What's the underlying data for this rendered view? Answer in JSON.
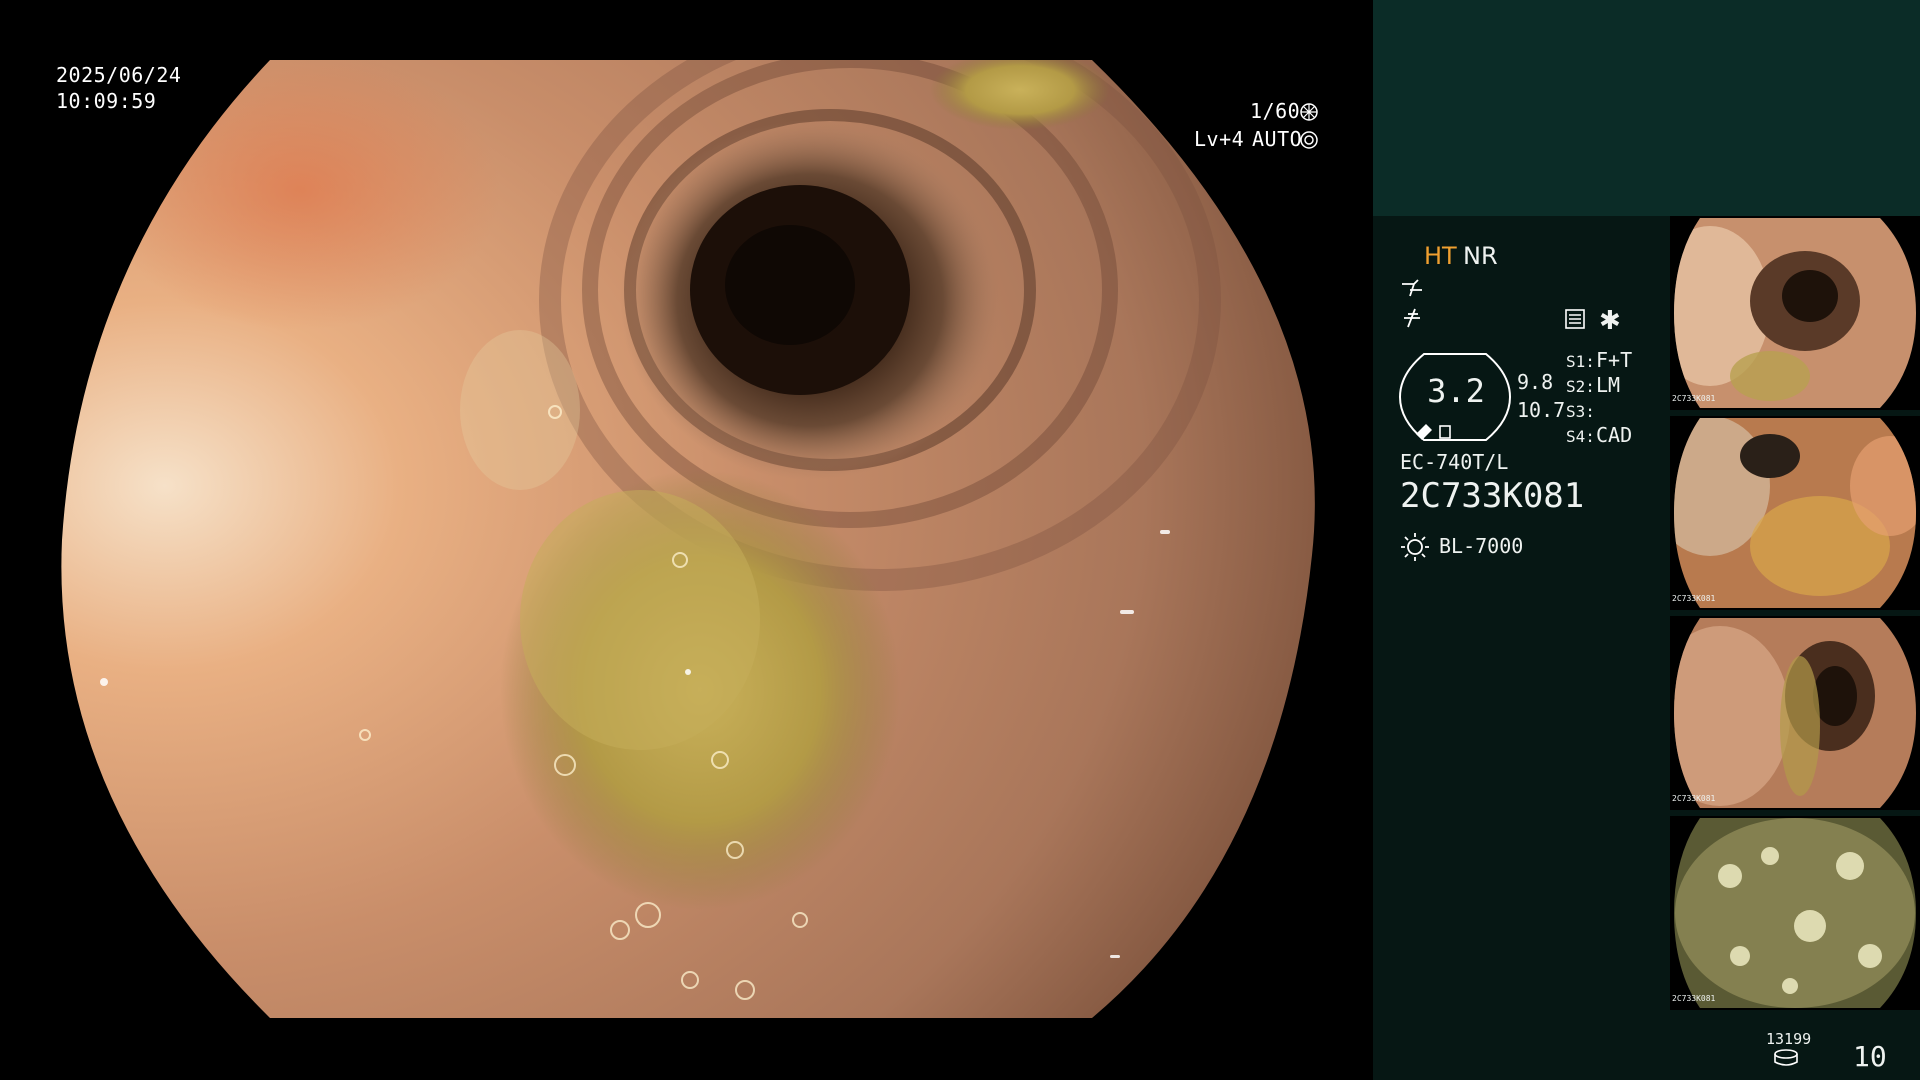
{
  "osd": {
    "date": "2025/06/24",
    "time": "10:09:59",
    "shutter": "1/60",
    "level": "Lv+4",
    "auto": "AUTO"
  },
  "panel": {
    "mode_ht": "HT",
    "mode_nr": "NR",
    "dial_value": "3.2",
    "dial_right_top": "9.8",
    "dial_right_bottom": "10.7",
    "switch_labels": [
      "S1:",
      "S2:",
      "S3:",
      "S4:"
    ],
    "switch_values": [
      "F+T",
      "LM",
      "",
      "CAD"
    ],
    "scope_model": "EC-740T/L",
    "serial": "2C733K081",
    "light_source": "BL-7000",
    "storage_count": "13199",
    "image_count": "10",
    "colors": {
      "highlight": "#f0a030",
      "panel_bg": "#061714",
      "panel_top": "#0b2c27"
    }
  },
  "thumbnails": [
    {
      "caption": "2C733K081"
    },
    {
      "caption": "2C733K081"
    },
    {
      "caption": "2C733K081"
    },
    {
      "caption": "2C733K081"
    }
  ]
}
